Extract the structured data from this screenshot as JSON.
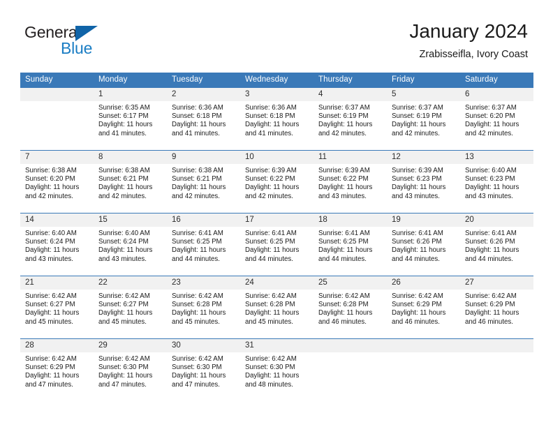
{
  "brand": {
    "name_part1": "General",
    "name_part2": "Blue",
    "accent_color": "#1064a8",
    "text_color": "#231f20"
  },
  "header": {
    "title": "January 2024",
    "subtitle": "Zrabisseifla, Ivory Coast"
  },
  "calendar": {
    "header_color": "#3a79b8",
    "daynum_band_color": "#f1f1f1",
    "weekdays": [
      "Sunday",
      "Monday",
      "Tuesday",
      "Wednesday",
      "Thursday",
      "Friday",
      "Saturday"
    ],
    "weeks": [
      [
        {
          "day": "",
          "sunrise": "",
          "sunset": "",
          "daylight_1": "",
          "daylight_2": ""
        },
        {
          "day": "1",
          "sunrise": "Sunrise: 6:35 AM",
          "sunset": "Sunset: 6:17 PM",
          "daylight_1": "Daylight: 11 hours",
          "daylight_2": "and 41 minutes."
        },
        {
          "day": "2",
          "sunrise": "Sunrise: 6:36 AM",
          "sunset": "Sunset: 6:18 PM",
          "daylight_1": "Daylight: 11 hours",
          "daylight_2": "and 41 minutes."
        },
        {
          "day": "3",
          "sunrise": "Sunrise: 6:36 AM",
          "sunset": "Sunset: 6:18 PM",
          "daylight_1": "Daylight: 11 hours",
          "daylight_2": "and 41 minutes."
        },
        {
          "day": "4",
          "sunrise": "Sunrise: 6:37 AM",
          "sunset": "Sunset: 6:19 PM",
          "daylight_1": "Daylight: 11 hours",
          "daylight_2": "and 42 minutes."
        },
        {
          "day": "5",
          "sunrise": "Sunrise: 6:37 AM",
          "sunset": "Sunset: 6:19 PM",
          "daylight_1": "Daylight: 11 hours",
          "daylight_2": "and 42 minutes."
        },
        {
          "day": "6",
          "sunrise": "Sunrise: 6:37 AM",
          "sunset": "Sunset: 6:20 PM",
          "daylight_1": "Daylight: 11 hours",
          "daylight_2": "and 42 minutes."
        }
      ],
      [
        {
          "day": "7",
          "sunrise": "Sunrise: 6:38 AM",
          "sunset": "Sunset: 6:20 PM",
          "daylight_1": "Daylight: 11 hours",
          "daylight_2": "and 42 minutes."
        },
        {
          "day": "8",
          "sunrise": "Sunrise: 6:38 AM",
          "sunset": "Sunset: 6:21 PM",
          "daylight_1": "Daylight: 11 hours",
          "daylight_2": "and 42 minutes."
        },
        {
          "day": "9",
          "sunrise": "Sunrise: 6:38 AM",
          "sunset": "Sunset: 6:21 PM",
          "daylight_1": "Daylight: 11 hours",
          "daylight_2": "and 42 minutes."
        },
        {
          "day": "10",
          "sunrise": "Sunrise: 6:39 AM",
          "sunset": "Sunset: 6:22 PM",
          "daylight_1": "Daylight: 11 hours",
          "daylight_2": "and 42 minutes."
        },
        {
          "day": "11",
          "sunrise": "Sunrise: 6:39 AM",
          "sunset": "Sunset: 6:22 PM",
          "daylight_1": "Daylight: 11 hours",
          "daylight_2": "and 43 minutes."
        },
        {
          "day": "12",
          "sunrise": "Sunrise: 6:39 AM",
          "sunset": "Sunset: 6:23 PM",
          "daylight_1": "Daylight: 11 hours",
          "daylight_2": "and 43 minutes."
        },
        {
          "day": "13",
          "sunrise": "Sunrise: 6:40 AM",
          "sunset": "Sunset: 6:23 PM",
          "daylight_1": "Daylight: 11 hours",
          "daylight_2": "and 43 minutes."
        }
      ],
      [
        {
          "day": "14",
          "sunrise": "Sunrise: 6:40 AM",
          "sunset": "Sunset: 6:24 PM",
          "daylight_1": "Daylight: 11 hours",
          "daylight_2": "and 43 minutes."
        },
        {
          "day": "15",
          "sunrise": "Sunrise: 6:40 AM",
          "sunset": "Sunset: 6:24 PM",
          "daylight_1": "Daylight: 11 hours",
          "daylight_2": "and 43 minutes."
        },
        {
          "day": "16",
          "sunrise": "Sunrise: 6:41 AM",
          "sunset": "Sunset: 6:25 PM",
          "daylight_1": "Daylight: 11 hours",
          "daylight_2": "and 44 minutes."
        },
        {
          "day": "17",
          "sunrise": "Sunrise: 6:41 AM",
          "sunset": "Sunset: 6:25 PM",
          "daylight_1": "Daylight: 11 hours",
          "daylight_2": "and 44 minutes."
        },
        {
          "day": "18",
          "sunrise": "Sunrise: 6:41 AM",
          "sunset": "Sunset: 6:25 PM",
          "daylight_1": "Daylight: 11 hours",
          "daylight_2": "and 44 minutes."
        },
        {
          "day": "19",
          "sunrise": "Sunrise: 6:41 AM",
          "sunset": "Sunset: 6:26 PM",
          "daylight_1": "Daylight: 11 hours",
          "daylight_2": "and 44 minutes."
        },
        {
          "day": "20",
          "sunrise": "Sunrise: 6:41 AM",
          "sunset": "Sunset: 6:26 PM",
          "daylight_1": "Daylight: 11 hours",
          "daylight_2": "and 44 minutes."
        }
      ],
      [
        {
          "day": "21",
          "sunrise": "Sunrise: 6:42 AM",
          "sunset": "Sunset: 6:27 PM",
          "daylight_1": "Daylight: 11 hours",
          "daylight_2": "and 45 minutes."
        },
        {
          "day": "22",
          "sunrise": "Sunrise: 6:42 AM",
          "sunset": "Sunset: 6:27 PM",
          "daylight_1": "Daylight: 11 hours",
          "daylight_2": "and 45 minutes."
        },
        {
          "day": "23",
          "sunrise": "Sunrise: 6:42 AM",
          "sunset": "Sunset: 6:28 PM",
          "daylight_1": "Daylight: 11 hours",
          "daylight_2": "and 45 minutes."
        },
        {
          "day": "24",
          "sunrise": "Sunrise: 6:42 AM",
          "sunset": "Sunset: 6:28 PM",
          "daylight_1": "Daylight: 11 hours",
          "daylight_2": "and 45 minutes."
        },
        {
          "day": "25",
          "sunrise": "Sunrise: 6:42 AM",
          "sunset": "Sunset: 6:28 PM",
          "daylight_1": "Daylight: 11 hours",
          "daylight_2": "and 46 minutes."
        },
        {
          "day": "26",
          "sunrise": "Sunrise: 6:42 AM",
          "sunset": "Sunset: 6:29 PM",
          "daylight_1": "Daylight: 11 hours",
          "daylight_2": "and 46 minutes."
        },
        {
          "day": "27",
          "sunrise": "Sunrise: 6:42 AM",
          "sunset": "Sunset: 6:29 PM",
          "daylight_1": "Daylight: 11 hours",
          "daylight_2": "and 46 minutes."
        }
      ],
      [
        {
          "day": "28",
          "sunrise": "Sunrise: 6:42 AM",
          "sunset": "Sunset: 6:29 PM",
          "daylight_1": "Daylight: 11 hours",
          "daylight_2": "and 47 minutes."
        },
        {
          "day": "29",
          "sunrise": "Sunrise: 6:42 AM",
          "sunset": "Sunset: 6:30 PM",
          "daylight_1": "Daylight: 11 hours",
          "daylight_2": "and 47 minutes."
        },
        {
          "day": "30",
          "sunrise": "Sunrise: 6:42 AM",
          "sunset": "Sunset: 6:30 PM",
          "daylight_1": "Daylight: 11 hours",
          "daylight_2": "and 47 minutes."
        },
        {
          "day": "31",
          "sunrise": "Sunrise: 6:42 AM",
          "sunset": "Sunset: 6:30 PM",
          "daylight_1": "Daylight: 11 hours",
          "daylight_2": "and 48 minutes."
        },
        {
          "day": "",
          "sunrise": "",
          "sunset": "",
          "daylight_1": "",
          "daylight_2": ""
        },
        {
          "day": "",
          "sunrise": "",
          "sunset": "",
          "daylight_1": "",
          "daylight_2": ""
        },
        {
          "day": "",
          "sunrise": "",
          "sunset": "",
          "daylight_1": "",
          "daylight_2": ""
        }
      ]
    ]
  }
}
